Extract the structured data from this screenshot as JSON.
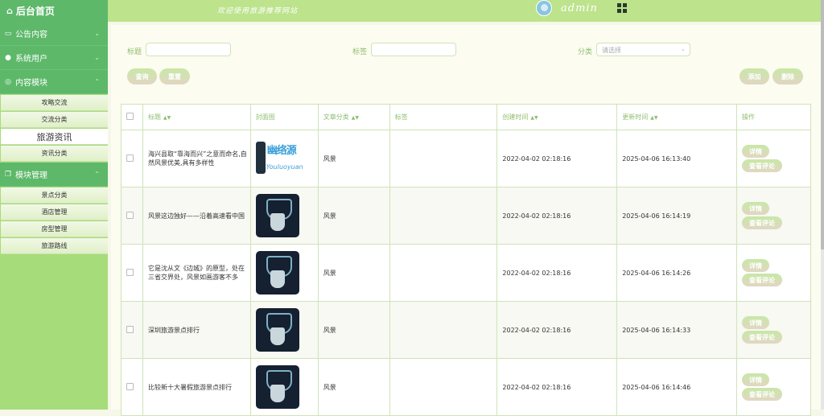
{
  "brand": {
    "title": "后台首页",
    "icon": "home-icon"
  },
  "header": {
    "welcome": "欢迎使用旅游推荐网站",
    "user": "admin"
  },
  "sidebar": [
    {
      "label": "公告内容",
      "icon": "monitor-icon",
      "items": []
    },
    {
      "label": "系统用户",
      "icon": "user-icon",
      "items": []
    },
    {
      "label": "内容模块",
      "icon": "chat-icon",
      "items": [
        "攻略交流",
        "交流分类",
        "旅游资讯",
        "资讯分类"
      ],
      "active": "旅游资讯"
    },
    {
      "label": "模块管理",
      "icon": "copy-icon",
      "items": [
        "景点分类",
        "酒店管理",
        "房型管理",
        "旅游路线"
      ]
    }
  ],
  "search": {
    "title_label": "标题",
    "tag_label": "标签",
    "cat_label": "分类",
    "cat_placeholder": "请选择",
    "query_btn": "查询",
    "reset_btn": "重置",
    "add_btn": "添加",
    "delete_btn": "删除"
  },
  "table": {
    "headers": [
      "标题",
      "封面图",
      "文章分类",
      "标签",
      "创建时间",
      "更新时间",
      "操作"
    ],
    "detail_btn": "详情",
    "comment_btn": "查看评论",
    "rows": [
      {
        "title": "海兴县取“靠海而兴”之意而命名,自然风景优美,具有多样性",
        "cover": "logo",
        "cover_text_1": "幽络源",
        "cover_text_2": "Youluoyuan",
        "category": "风景",
        "tag": "",
        "created": "2022-04-02 02:18:16",
        "updated": "2025-04-06 16:13:40"
      },
      {
        "title": "风景这边独好——沿着高速看中国",
        "cover": "mask",
        "category": "风景",
        "tag": "",
        "created": "2022-04-02 02:18:16",
        "updated": "2025-04-06 16:14:19"
      },
      {
        "title": "它是沈从文《边城》的原型，处在三省交界处，风景如画游客不多",
        "cover": "mask",
        "category": "风景",
        "tag": "",
        "created": "2022-04-02 02:18:16",
        "updated": "2025-04-06 16:14:26"
      },
      {
        "title": "深圳旅游景点排行",
        "cover": "mask",
        "category": "风景",
        "tag": "",
        "created": "2022-04-02 02:18:16",
        "updated": "2025-04-06 16:14:33"
      },
      {
        "title": "比较新十大暑假旅游景点排行",
        "cover": "mask",
        "category": "风景",
        "tag": "",
        "created": "2022-04-02 02:18:16",
        "updated": "2025-04-06 16:14:46"
      }
    ]
  }
}
